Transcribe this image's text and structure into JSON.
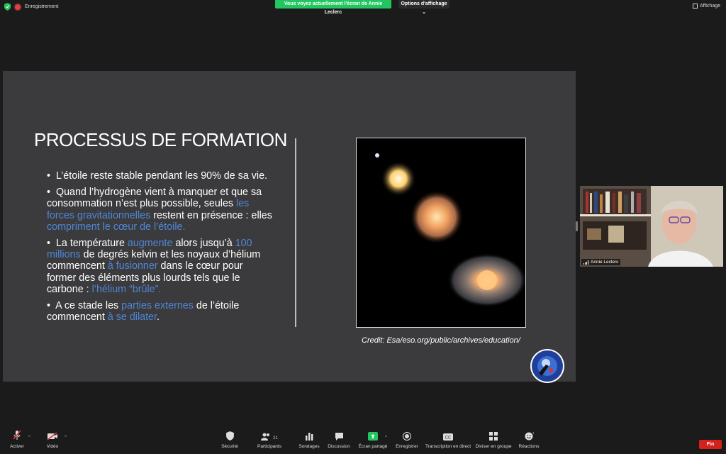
{
  "top_bar": {
    "recording_label": "Enregistrement",
    "share_banner": "Vous voyez actuellement l'écran de Annie Leclerc",
    "view_options": "Options d'affichage",
    "view_button": "Affichage"
  },
  "slide": {
    "title": "PROCESSUS DE FORMATION",
    "bullets": [
      {
        "t1": "L’étoile reste stable pendant les 90% de sa vie."
      },
      {
        "t1": "Quand l’hydrogène vient à manquer et que sa consommation n’est plus possible, seules ",
        "h1": "les forces gravitationnelles",
        "t2": " restent en présence : elles ",
        "h2": "compriment le cœur de l’étoile."
      },
      {
        "t1": "La température ",
        "h1": "augmente",
        "t2": " alors jusqu’à ",
        "h2": "100 millions",
        "t3": " de degrés kelvin et les noyaux d’hélium commencent ",
        "h3": "à fusionner",
        "t4": " dans le cœur pour former des éléments plus lourds tels que le carbone : ",
        "h4": "l’hélium “brûle”."
      },
      {
        "t1": "A ce stade les ",
        "h1": "parties externes",
        "t2": " de l’étoile commencent ",
        "h2": "à se dilater",
        "t3": "."
      }
    ],
    "credit": "Credit: Esa/eso.org/public/archives/education/",
    "highlight_color": "#4f86d6"
  },
  "participant": {
    "name": "Annie Leclerc"
  },
  "toolbar": {
    "mute_label": "Activer",
    "video_label": "Vidéo",
    "security_label": "Sécurité",
    "participants_label": "Participants",
    "participants_count": "21",
    "polls_label": "Sondages",
    "chat_label": "Discussion",
    "share_label": "Écran partagé",
    "record_label": "Enregistrer",
    "cc_label": "Transcription en direct",
    "breakout_label": "Diviser en groupe",
    "reactions_label": "Réactions",
    "end_label": "Fin",
    "accent_green": "#23c560",
    "end_color": "#d3221c"
  }
}
